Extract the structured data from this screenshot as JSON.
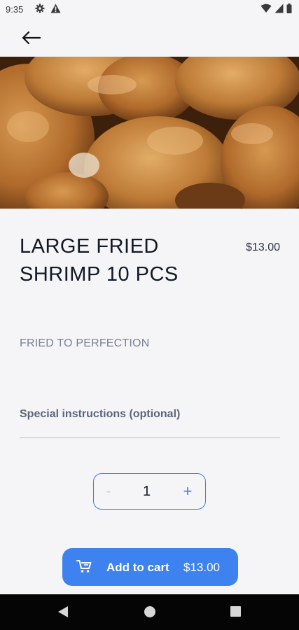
{
  "status_bar": {
    "time": "9:35",
    "left_icons": [
      "gear-icon",
      "alert-icon"
    ],
    "right_icons": [
      "wifi-icon",
      "signal-icon",
      "battery-icon"
    ]
  },
  "top_bar": {
    "back_icon": "arrow-left-icon"
  },
  "hero": {
    "description": "fried-shrimp-photo"
  },
  "item": {
    "title": "LARGE FRIED SHRIMP 10 PCS",
    "price": "$13.00",
    "description": "FRIED TO PERFECTION"
  },
  "instructions": {
    "placeholder": "Special instructions (optional)",
    "value": ""
  },
  "quantity": {
    "minus": "-",
    "value": "1",
    "plus": "+"
  },
  "cart_button": {
    "icon": "cart-icon",
    "label": "Add to cart",
    "total": "$13.00"
  },
  "colors": {
    "accent": "#3d82ee",
    "background": "#f5f5f7",
    "nav_bar": "#050505"
  },
  "nav_bar": {
    "icons": [
      "back-triangle-icon",
      "home-circle-icon",
      "recents-square-icon"
    ]
  }
}
